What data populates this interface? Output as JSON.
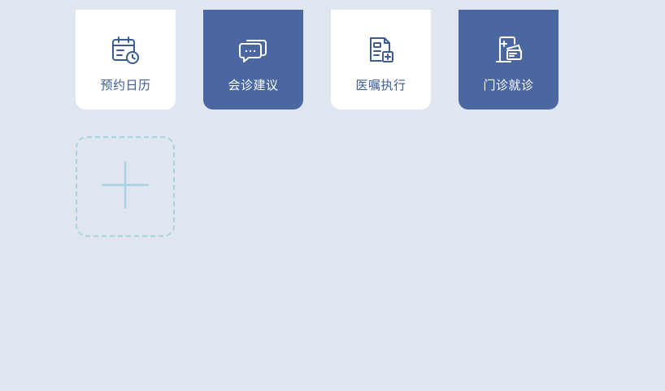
{
  "tiles": [
    {
      "label": "预约日历",
      "icon": "calendar-clock-icon",
      "style": "light"
    },
    {
      "label": "会诊建议",
      "icon": "chat-bubbles-icon",
      "style": "dark"
    },
    {
      "label": "医嘱执行",
      "icon": "medical-document-icon",
      "style": "light"
    },
    {
      "label": "门诊就诊",
      "icon": "clinic-card-icon",
      "style": "dark"
    }
  ],
  "add_tile": {
    "icon": "plus-icon"
  },
  "colors": {
    "background": "#dfe6ef",
    "tile_light": "#ffffff",
    "tile_dark": "#4b67a0",
    "accent_text": "#3b5b95",
    "add_border": "#a8d4e2"
  }
}
